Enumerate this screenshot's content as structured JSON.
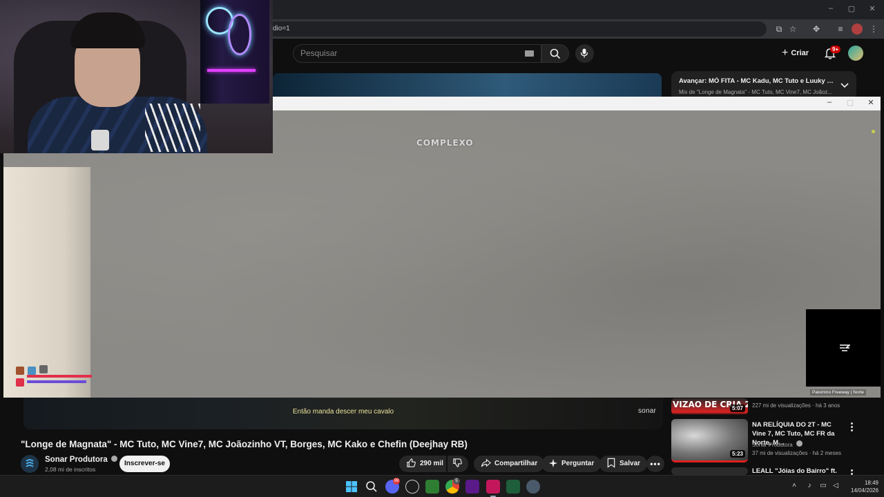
{
  "browser": {
    "url_fragment": "dio=1",
    "window_controls": [
      "–",
      "▢",
      "✕"
    ]
  },
  "header": {
    "search_placeholder": "Pesquisar",
    "create_label": "Criar",
    "notif_badge": "9+"
  },
  "upnext": {
    "title": "Avançar: MÓ FITA - MC Kadu, MC Tuto e Luuky (We...",
    "subtitle": "Mix de \"Longe de Magnata\" - MC Tuto, MC Vine7, MC Joãoz..."
  },
  "player": {
    "lyric": "Então manda descer meu cavalo",
    "watermark": "sonar"
  },
  "video": {
    "title": "\"Longe de Magnata\" - MC Tuto, MC Vine7, MC Joãozinho VT, Borges, MC Kako e Chefin (Deejhay RB)",
    "channel": "Sonar Produtora",
    "subscribers": "2,08 mi de inscritos",
    "subscribe_label": "Inscrever-se",
    "likes": "290 mil",
    "share_label": "Compartilhar",
    "ask_label": "Perguntar",
    "save_label": "Salvar"
  },
  "recommendations": [
    {
      "thumb_text": "VIZAO DE CRIA 2",
      "duration": "5:07",
      "meta": "227 mi de visualizações · há 3 anos"
    },
    {
      "title": "NA RELÍQUIA DO 2T - MC Vine 7, MC Tuto, MC FR da Norte, M...",
      "channel": "Sonar Produtora",
      "meta": "37 mi de visualizações · há 2 meses",
      "duration": "5:23"
    },
    {
      "title": "LEALL \"Jóias do Bairro\" ft."
    }
  ],
  "game": {
    "brand": "COMPLEXO",
    "street": "Palomino Freeway",
    "street_suffix": "| Norte"
  },
  "taskbar": {
    "time": "18:49",
    "date": "14/04/2026",
    "discord_badge": "99",
    "steam_badge": "5"
  },
  "colors": {
    "accent_red": "#cc0000",
    "lyric_yellow": "#ede39c",
    "health_red": "#e0304a",
    "armor_purple": "#6a4cd8"
  }
}
